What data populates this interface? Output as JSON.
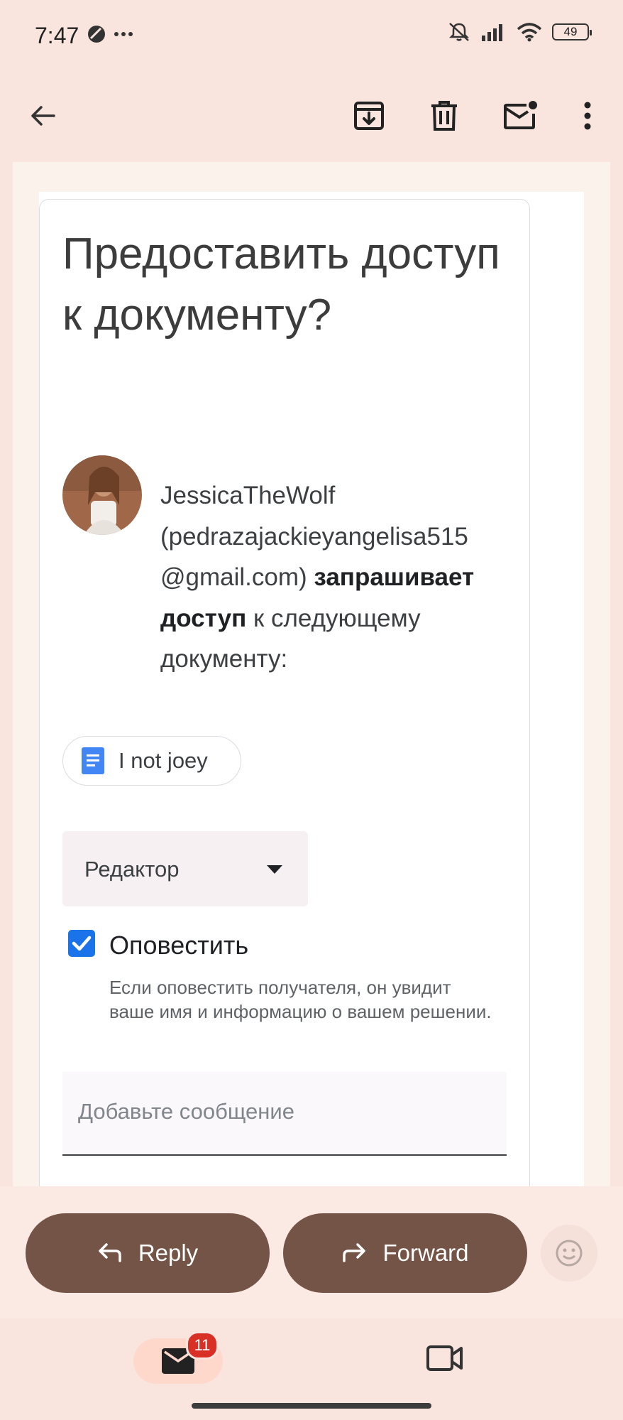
{
  "status": {
    "time": "7:47",
    "battery": "49"
  },
  "email": {
    "title": "Предоставить доступ к документу?",
    "requester_name": "JessicaTheWolf",
    "requester_email": "(pedrazajackieyangelisa515 @gmail.com)",
    "request_bold": "запрашивает доступ",
    "request_rest": "к следующему документу:",
    "document_name": "I not joey",
    "role": "Редактор",
    "notify_label": "Оповестить",
    "notify_help": "Если оповестить получателя, он увидит ваше имя и информацию о вашем решении.",
    "message_placeholder": "Добавьте сообщение",
    "notify_checked": true
  },
  "actions": {
    "reply": "Reply",
    "forward": "Forward"
  },
  "nav": {
    "mail_badge": "11"
  },
  "colors": {
    "accent_brown": "#735446",
    "checkbox_blue": "#1a73e8",
    "doc_icon_blue": "#4285f4",
    "badge_red": "#d93025"
  },
  "icons": {
    "back": "arrow-left-icon",
    "archive": "archive-icon",
    "delete": "trash-icon",
    "mark_unread": "mail-unread-icon",
    "more": "more-vert-icon",
    "reply": "reply-icon",
    "forward": "forward-icon",
    "emoji": "emoji-icon",
    "mail": "mail-icon",
    "meet": "video-icon"
  }
}
